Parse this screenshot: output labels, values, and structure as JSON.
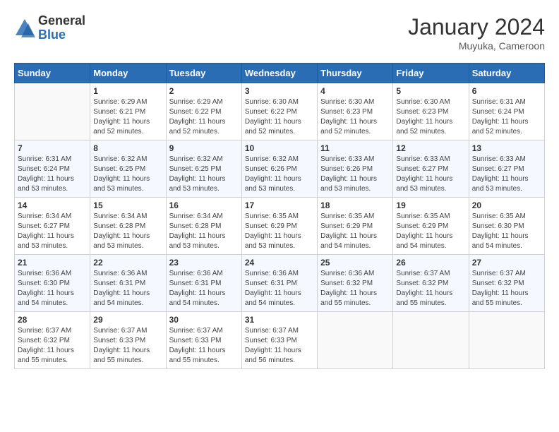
{
  "logo": {
    "general": "General",
    "blue": "Blue"
  },
  "header": {
    "month_year": "January 2024",
    "location": "Muyuka, Cameroon"
  },
  "days_of_week": [
    "Sunday",
    "Monday",
    "Tuesday",
    "Wednesday",
    "Thursday",
    "Friday",
    "Saturday"
  ],
  "weeks": [
    [
      {
        "num": "",
        "empty": true
      },
      {
        "num": "1",
        "sunrise": "6:29 AM",
        "sunset": "6:21 PM",
        "daylight": "11 hours and 52 minutes."
      },
      {
        "num": "2",
        "sunrise": "6:29 AM",
        "sunset": "6:22 PM",
        "daylight": "11 hours and 52 minutes."
      },
      {
        "num": "3",
        "sunrise": "6:30 AM",
        "sunset": "6:22 PM",
        "daylight": "11 hours and 52 minutes."
      },
      {
        "num": "4",
        "sunrise": "6:30 AM",
        "sunset": "6:23 PM",
        "daylight": "11 hours and 52 minutes."
      },
      {
        "num": "5",
        "sunrise": "6:30 AM",
        "sunset": "6:23 PM",
        "daylight": "11 hours and 52 minutes."
      },
      {
        "num": "6",
        "sunrise": "6:31 AM",
        "sunset": "6:24 PM",
        "daylight": "11 hours and 52 minutes."
      }
    ],
    [
      {
        "num": "7",
        "sunrise": "6:31 AM",
        "sunset": "6:24 PM",
        "daylight": "11 hours and 53 minutes."
      },
      {
        "num": "8",
        "sunrise": "6:32 AM",
        "sunset": "6:25 PM",
        "daylight": "11 hours and 53 minutes."
      },
      {
        "num": "9",
        "sunrise": "6:32 AM",
        "sunset": "6:25 PM",
        "daylight": "11 hours and 53 minutes."
      },
      {
        "num": "10",
        "sunrise": "6:32 AM",
        "sunset": "6:26 PM",
        "daylight": "11 hours and 53 minutes."
      },
      {
        "num": "11",
        "sunrise": "6:33 AM",
        "sunset": "6:26 PM",
        "daylight": "11 hours and 53 minutes."
      },
      {
        "num": "12",
        "sunrise": "6:33 AM",
        "sunset": "6:27 PM",
        "daylight": "11 hours and 53 minutes."
      },
      {
        "num": "13",
        "sunrise": "6:33 AM",
        "sunset": "6:27 PM",
        "daylight": "11 hours and 53 minutes."
      }
    ],
    [
      {
        "num": "14",
        "sunrise": "6:34 AM",
        "sunset": "6:27 PM",
        "daylight": "11 hours and 53 minutes."
      },
      {
        "num": "15",
        "sunrise": "6:34 AM",
        "sunset": "6:28 PM",
        "daylight": "11 hours and 53 minutes."
      },
      {
        "num": "16",
        "sunrise": "6:34 AM",
        "sunset": "6:28 PM",
        "daylight": "11 hours and 53 minutes."
      },
      {
        "num": "17",
        "sunrise": "6:35 AM",
        "sunset": "6:29 PM",
        "daylight": "11 hours and 53 minutes."
      },
      {
        "num": "18",
        "sunrise": "6:35 AM",
        "sunset": "6:29 PM",
        "daylight": "11 hours and 54 minutes."
      },
      {
        "num": "19",
        "sunrise": "6:35 AM",
        "sunset": "6:29 PM",
        "daylight": "11 hours and 54 minutes."
      },
      {
        "num": "20",
        "sunrise": "6:35 AM",
        "sunset": "6:30 PM",
        "daylight": "11 hours and 54 minutes."
      }
    ],
    [
      {
        "num": "21",
        "sunrise": "6:36 AM",
        "sunset": "6:30 PM",
        "daylight": "11 hours and 54 minutes."
      },
      {
        "num": "22",
        "sunrise": "6:36 AM",
        "sunset": "6:31 PM",
        "daylight": "11 hours and 54 minutes."
      },
      {
        "num": "23",
        "sunrise": "6:36 AM",
        "sunset": "6:31 PM",
        "daylight": "11 hours and 54 minutes."
      },
      {
        "num": "24",
        "sunrise": "6:36 AM",
        "sunset": "6:31 PM",
        "daylight": "11 hours and 54 minutes."
      },
      {
        "num": "25",
        "sunrise": "6:36 AM",
        "sunset": "6:32 PM",
        "daylight": "11 hours and 55 minutes."
      },
      {
        "num": "26",
        "sunrise": "6:37 AM",
        "sunset": "6:32 PM",
        "daylight": "11 hours and 55 minutes."
      },
      {
        "num": "27",
        "sunrise": "6:37 AM",
        "sunset": "6:32 PM",
        "daylight": "11 hours and 55 minutes."
      }
    ],
    [
      {
        "num": "28",
        "sunrise": "6:37 AM",
        "sunset": "6:32 PM",
        "daylight": "11 hours and 55 minutes."
      },
      {
        "num": "29",
        "sunrise": "6:37 AM",
        "sunset": "6:33 PM",
        "daylight": "11 hours and 55 minutes."
      },
      {
        "num": "30",
        "sunrise": "6:37 AM",
        "sunset": "6:33 PM",
        "daylight": "11 hours and 55 minutes."
      },
      {
        "num": "31",
        "sunrise": "6:37 AM",
        "sunset": "6:33 PM",
        "daylight": "11 hours and 56 minutes."
      },
      {
        "num": "",
        "empty": true
      },
      {
        "num": "",
        "empty": true
      },
      {
        "num": "",
        "empty": true
      }
    ]
  ]
}
